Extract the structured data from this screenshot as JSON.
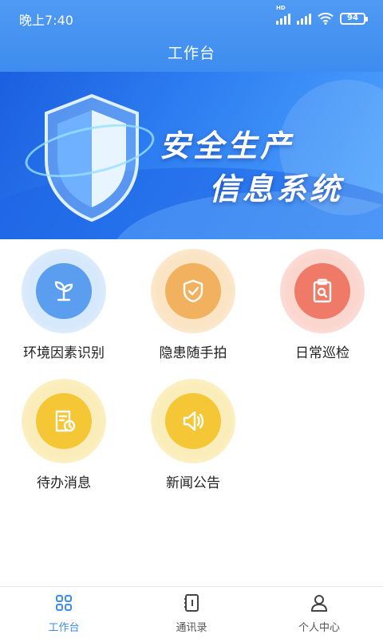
{
  "status_bar": {
    "time": "晚上7:40",
    "battery": "94",
    "network_label": "HD"
  },
  "header": {
    "title": "工作台"
  },
  "banner": {
    "line1": "安全生产",
    "line2": "信息系统"
  },
  "tiles": [
    {
      "label": "环境因素识别",
      "icon": "plant-icon",
      "color": "#5b9ef0"
    },
    {
      "label": "隐患随手拍",
      "icon": "shield-check-icon",
      "color": "#f2b15e"
    },
    {
      "label": "日常巡检",
      "icon": "clipboard-search-icon",
      "color": "#f07a68"
    },
    {
      "label": "待办消息",
      "icon": "document-clock-icon",
      "color": "#f5c736"
    },
    {
      "label": "新闻公告",
      "icon": "speaker-icon",
      "color": "#f5c736"
    }
  ],
  "bottom_nav": [
    {
      "label": "工作台",
      "icon": "grid-icon",
      "active": true
    },
    {
      "label": "通讯录",
      "icon": "contacts-book-icon",
      "active": false
    },
    {
      "label": "个人中心",
      "icon": "person-icon",
      "active": false
    }
  ],
  "colors": {
    "primary": "#3d8cf0",
    "active_nav": "#3d8cf0"
  }
}
